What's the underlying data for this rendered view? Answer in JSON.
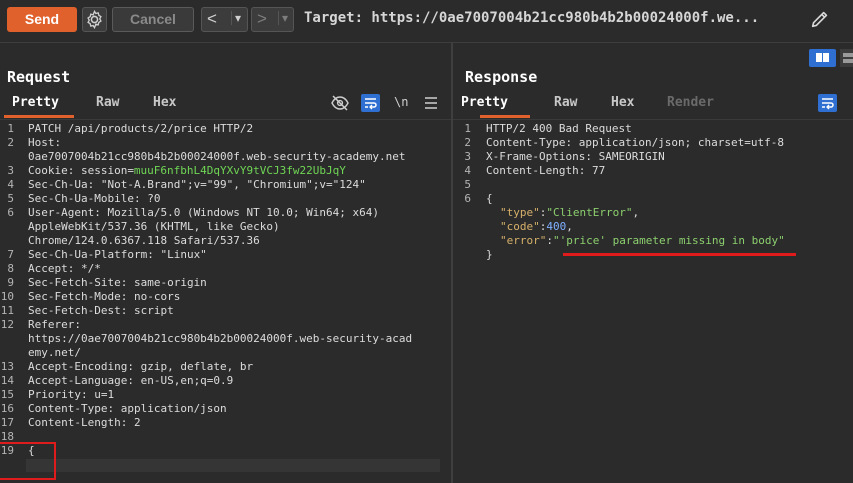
{
  "toolbar": {
    "send": "Send",
    "cancel": "Cancel",
    "back": "<",
    "forward": ">",
    "dropdown": "▾",
    "target": "Target: https://0ae7007004b21cc980b4b2b00024000f.we..."
  },
  "request": {
    "title": "Request",
    "tabs": [
      "Pretty",
      "Raw",
      "Hex"
    ],
    "newline_label": "\\n",
    "lines": [
      {
        "n": "1",
        "t": "PATCH /api/products/2/price HTTP/2"
      },
      {
        "n": "2",
        "t": "Host:"
      },
      {
        "n": "",
        "t": "0ae7007004b21cc980b4b2b00024000f.web-security-academy.net"
      },
      {
        "n": "3",
        "t": "Cookie: session=",
        "v": "muuF6nfbhL4DqYXvY9tVCJ3fw22UbJqY"
      },
      {
        "n": "4",
        "t": "Sec-Ch-Ua: \"Not-A.Brand\";v=\"99\", \"Chromium\";v=\"124\""
      },
      {
        "n": "5",
        "t": "Sec-Ch-Ua-Mobile: ?0"
      },
      {
        "n": "6",
        "t": "User-Agent: Mozilla/5.0 (Windows NT 10.0; Win64; x64)"
      },
      {
        "n": "",
        "t": "AppleWebKit/537.36 (KHTML, like Gecko)"
      },
      {
        "n": "",
        "t": "Chrome/124.0.6367.118 Safari/537.36"
      },
      {
        "n": "7",
        "t": "Sec-Ch-Ua-Platform: \"Linux\""
      },
      {
        "n": "8",
        "t": "Accept: */*"
      },
      {
        "n": "9",
        "t": "Sec-Fetch-Site: same-origin"
      },
      {
        "n": "10",
        "t": "Sec-Fetch-Mode: no-cors"
      },
      {
        "n": "11",
        "t": "Sec-Fetch-Dest: script"
      },
      {
        "n": "12",
        "t": "Referer:"
      },
      {
        "n": "",
        "t": "https://0ae7007004b21cc980b4b2b00024000f.web-security-acad"
      },
      {
        "n": "",
        "t": "emy.net/"
      },
      {
        "n": "13",
        "t": "Accept-Encoding: gzip, deflate, br"
      },
      {
        "n": "14",
        "t": "Accept-Language: en-US,en;q=0.9"
      },
      {
        "n": "15",
        "t": "Priority: u=1"
      },
      {
        "n": "16",
        "t": "Content-Type: application/json"
      },
      {
        "n": "17",
        "t": "Content-Length: 2"
      },
      {
        "n": "18",
        "t": ""
      },
      {
        "n": "19",
        "t": "{"
      },
      {
        "n": "",
        "t": "}"
      }
    ]
  },
  "response": {
    "title": "Response",
    "tabs": [
      "Pretty",
      "Raw",
      "Hex",
      "Render"
    ],
    "lines": [
      {
        "n": "1",
        "t": "HTTP/2 400 Bad Request"
      },
      {
        "n": "2",
        "t": "Content-Type: application/json; charset=utf-8"
      },
      {
        "n": "3",
        "t": "X-Frame-Options: SAMEORIGIN"
      },
      {
        "n": "4",
        "t": "Content-Length: 77"
      },
      {
        "n": "5",
        "t": ""
      },
      {
        "n": "6",
        "t": "{"
      }
    ],
    "json": {
      "type_key": "\"type\"",
      "type_val": "\"ClientError\"",
      "code_key": "\"code\"",
      "code_val": "400",
      "error_key": "\"error\"",
      "error_val": "\"'price' parameter missing in body\"",
      "close": "}"
    }
  }
}
